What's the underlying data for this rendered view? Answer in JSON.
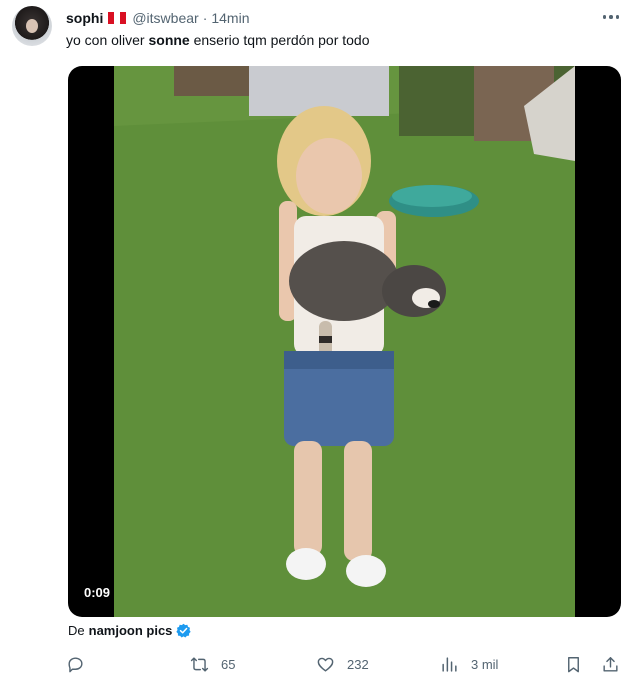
{
  "post": {
    "display_name": "sophi",
    "handle": "@itswbear",
    "separator": "·",
    "time": "14min",
    "text_before": "yo con oliver ",
    "text_bold": "sonne",
    "text_after": " enserio tqm perdón por todo",
    "flag": "peru-flag",
    "more": "more-icon"
  },
  "video": {
    "timestamp": "0:09"
  },
  "source": {
    "prefix": "De",
    "account": "namjoon pics",
    "verified_color": "#1d9bf0"
  },
  "actions": {
    "reply": {
      "icon": "reply-icon",
      "count": ""
    },
    "repost": {
      "icon": "repost-icon",
      "count": "65"
    },
    "like": {
      "icon": "heart-icon",
      "count": "232"
    },
    "views": {
      "icon": "views-icon",
      "count": "3 mil"
    },
    "bookmark": {
      "icon": "bookmark-icon"
    },
    "share": {
      "icon": "share-icon"
    }
  },
  "colors": {
    "text": "#0f1419",
    "secondary": "#536471",
    "accent": "#1d9bf0"
  }
}
